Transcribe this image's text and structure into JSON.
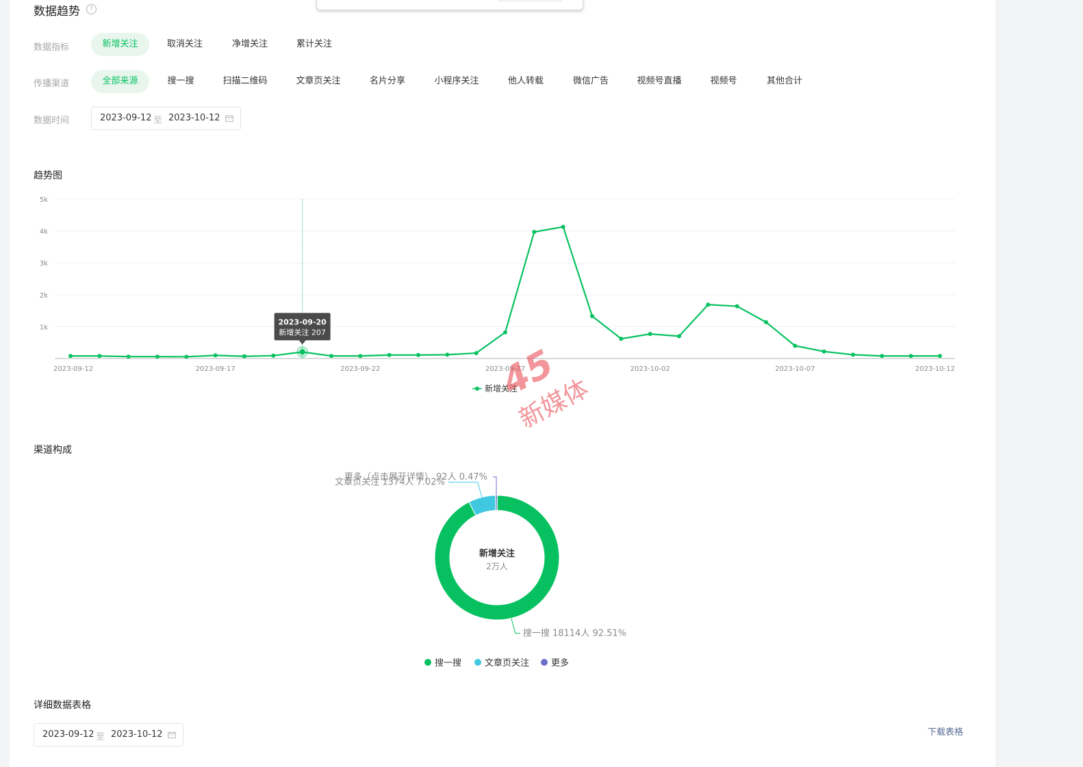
{
  "header": {
    "title": "数据趋势",
    "help_icon": "question-circle-icon"
  },
  "filters": {
    "metric": {
      "label": "数据指标",
      "options": [
        "新增关注",
        "取消关注",
        "净增关注",
        "累计关注"
      ],
      "selected": "新增关注"
    },
    "channel": {
      "label": "传播渠道",
      "options": [
        "全部来源",
        "搜一搜",
        "扫描二维码",
        "文章页关注",
        "名片分享",
        "小程序关注",
        "他人转载",
        "微信广告",
        "视频号直播",
        "视频号",
        "其他合计"
      ],
      "selected": "全部来源"
    },
    "date": {
      "label": "数据时间",
      "start": "2023-09-12",
      "separator": "至",
      "end": "2023-10-12",
      "icon": "calendar-icon"
    }
  },
  "trend": {
    "title": "趋势图",
    "tooltip": {
      "date": "2023-09-20",
      "text": "新增关注 207"
    },
    "legend": "新增关注"
  },
  "composition": {
    "title": "渠道构成",
    "center_title": "新增关注",
    "center_value": "2万人",
    "labels": {
      "more": "更多（点击展开详情） 92人 0.47%",
      "article": "文章页关注 1374人 7.02%",
      "search": "搜一搜 18114人 92.51%"
    },
    "legend": [
      "搜一搜",
      "文章页关注",
      "更多"
    ]
  },
  "table_section": {
    "title": "详细数据表格",
    "date": {
      "start": "2023-09-12",
      "separator": "至",
      "end": "2023-10-12",
      "icon": "calendar-icon"
    },
    "download": "下载表格"
  },
  "watermark": {
    "logo_text": "45",
    "brand_text": "新媒体"
  },
  "colors": {
    "accent": "#07c160",
    "chip_bg": "#e8f6ee",
    "cyan": "#40c8e0",
    "purple": "#6a6fc9",
    "watermark": "#e8424b"
  },
  "chart_data": [
    {
      "type": "line",
      "title": "趋势图",
      "series": [
        {
          "name": "新增关注",
          "x": [
            "2023-09-12",
            "2023-09-13",
            "2023-09-14",
            "2023-09-15",
            "2023-09-16",
            "2023-09-17",
            "2023-09-18",
            "2023-09-19",
            "2023-09-20",
            "2023-09-21",
            "2023-09-22",
            "2023-09-23",
            "2023-09-24",
            "2023-09-25",
            "2023-09-26",
            "2023-09-27",
            "2023-09-28",
            "2023-09-29",
            "2023-09-30",
            "2023-10-01",
            "2023-10-02",
            "2023-10-03",
            "2023-10-04",
            "2023-10-05",
            "2023-10-06",
            "2023-10-07",
            "2023-10-08",
            "2023-10-09",
            "2023-10-10",
            "2023-10-11",
            "2023-10-12"
          ],
          "values": [
            80,
            80,
            60,
            60,
            55,
            100,
            70,
            90,
            207,
            80,
            80,
            110,
            110,
            120,
            170,
            820,
            3970,
            4130,
            1330,
            620,
            770,
            700,
            1690,
            1640,
            1140,
            400,
            220,
            120,
            80,
            80,
            80
          ]
        }
      ],
      "x_tick_labels": [
        "2023-09-12",
        "2023-09-17",
        "2023-09-22",
        "2023-09-27",
        "2023-10-02",
        "2023-10-07",
        "2023-10-12"
      ],
      "y_tick_labels": [
        "1k",
        "2k",
        "3k",
        "4k",
        "5k"
      ],
      "ylim": [
        0,
        5000
      ],
      "grid": true,
      "legend": "bottom-center"
    },
    {
      "type": "pie",
      "title": "渠道构成",
      "categories": [
        "搜一搜",
        "文章页关注",
        "更多"
      ],
      "values": [
        18114,
        1374,
        92
      ],
      "percentages": [
        92.51,
        7.02,
        0.47
      ],
      "colors": [
        "#07c160",
        "#40c8e0",
        "#6a6fc9"
      ],
      "legend": "bottom-center"
    }
  ]
}
